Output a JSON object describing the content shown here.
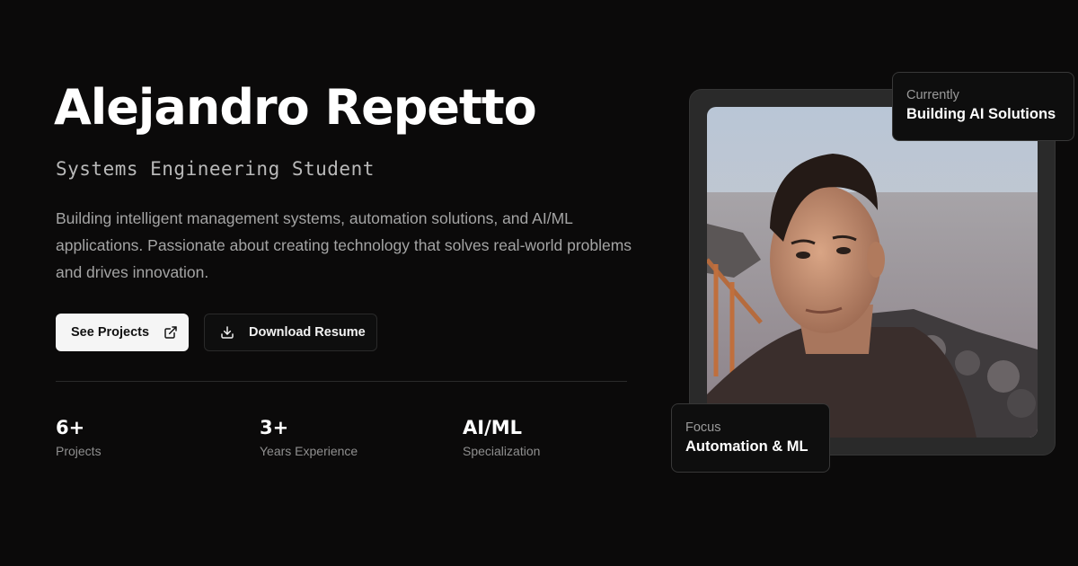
{
  "hero": {
    "name": "Alejandro Repetto",
    "role": "Systems Engineering Student",
    "description": "Building intelligent management systems, automation solutions, and AI/ML applications. Passionate about creating technology that solves real-world problems and drives innovation."
  },
  "actions": {
    "primary": {
      "label": "See Projects",
      "icon": "external-link-icon"
    },
    "secondary": {
      "label": "Download Resume",
      "icon": "download-icon"
    }
  },
  "stats": [
    {
      "value": "6+",
      "label": "Projects"
    },
    {
      "value": "3+",
      "label": "Years Experience"
    },
    {
      "value": "AI/ML",
      "label": "Specialization"
    }
  ],
  "badges": {
    "top": {
      "label": "Currently",
      "value": "Building AI Solutions"
    },
    "bottom": {
      "label": "Focus",
      "value": "Automation & ML"
    }
  },
  "colors": {
    "background": "#0b0a0a",
    "primary_button_bg": "#f5f5f5",
    "card_bg": "#0e0e0e"
  }
}
